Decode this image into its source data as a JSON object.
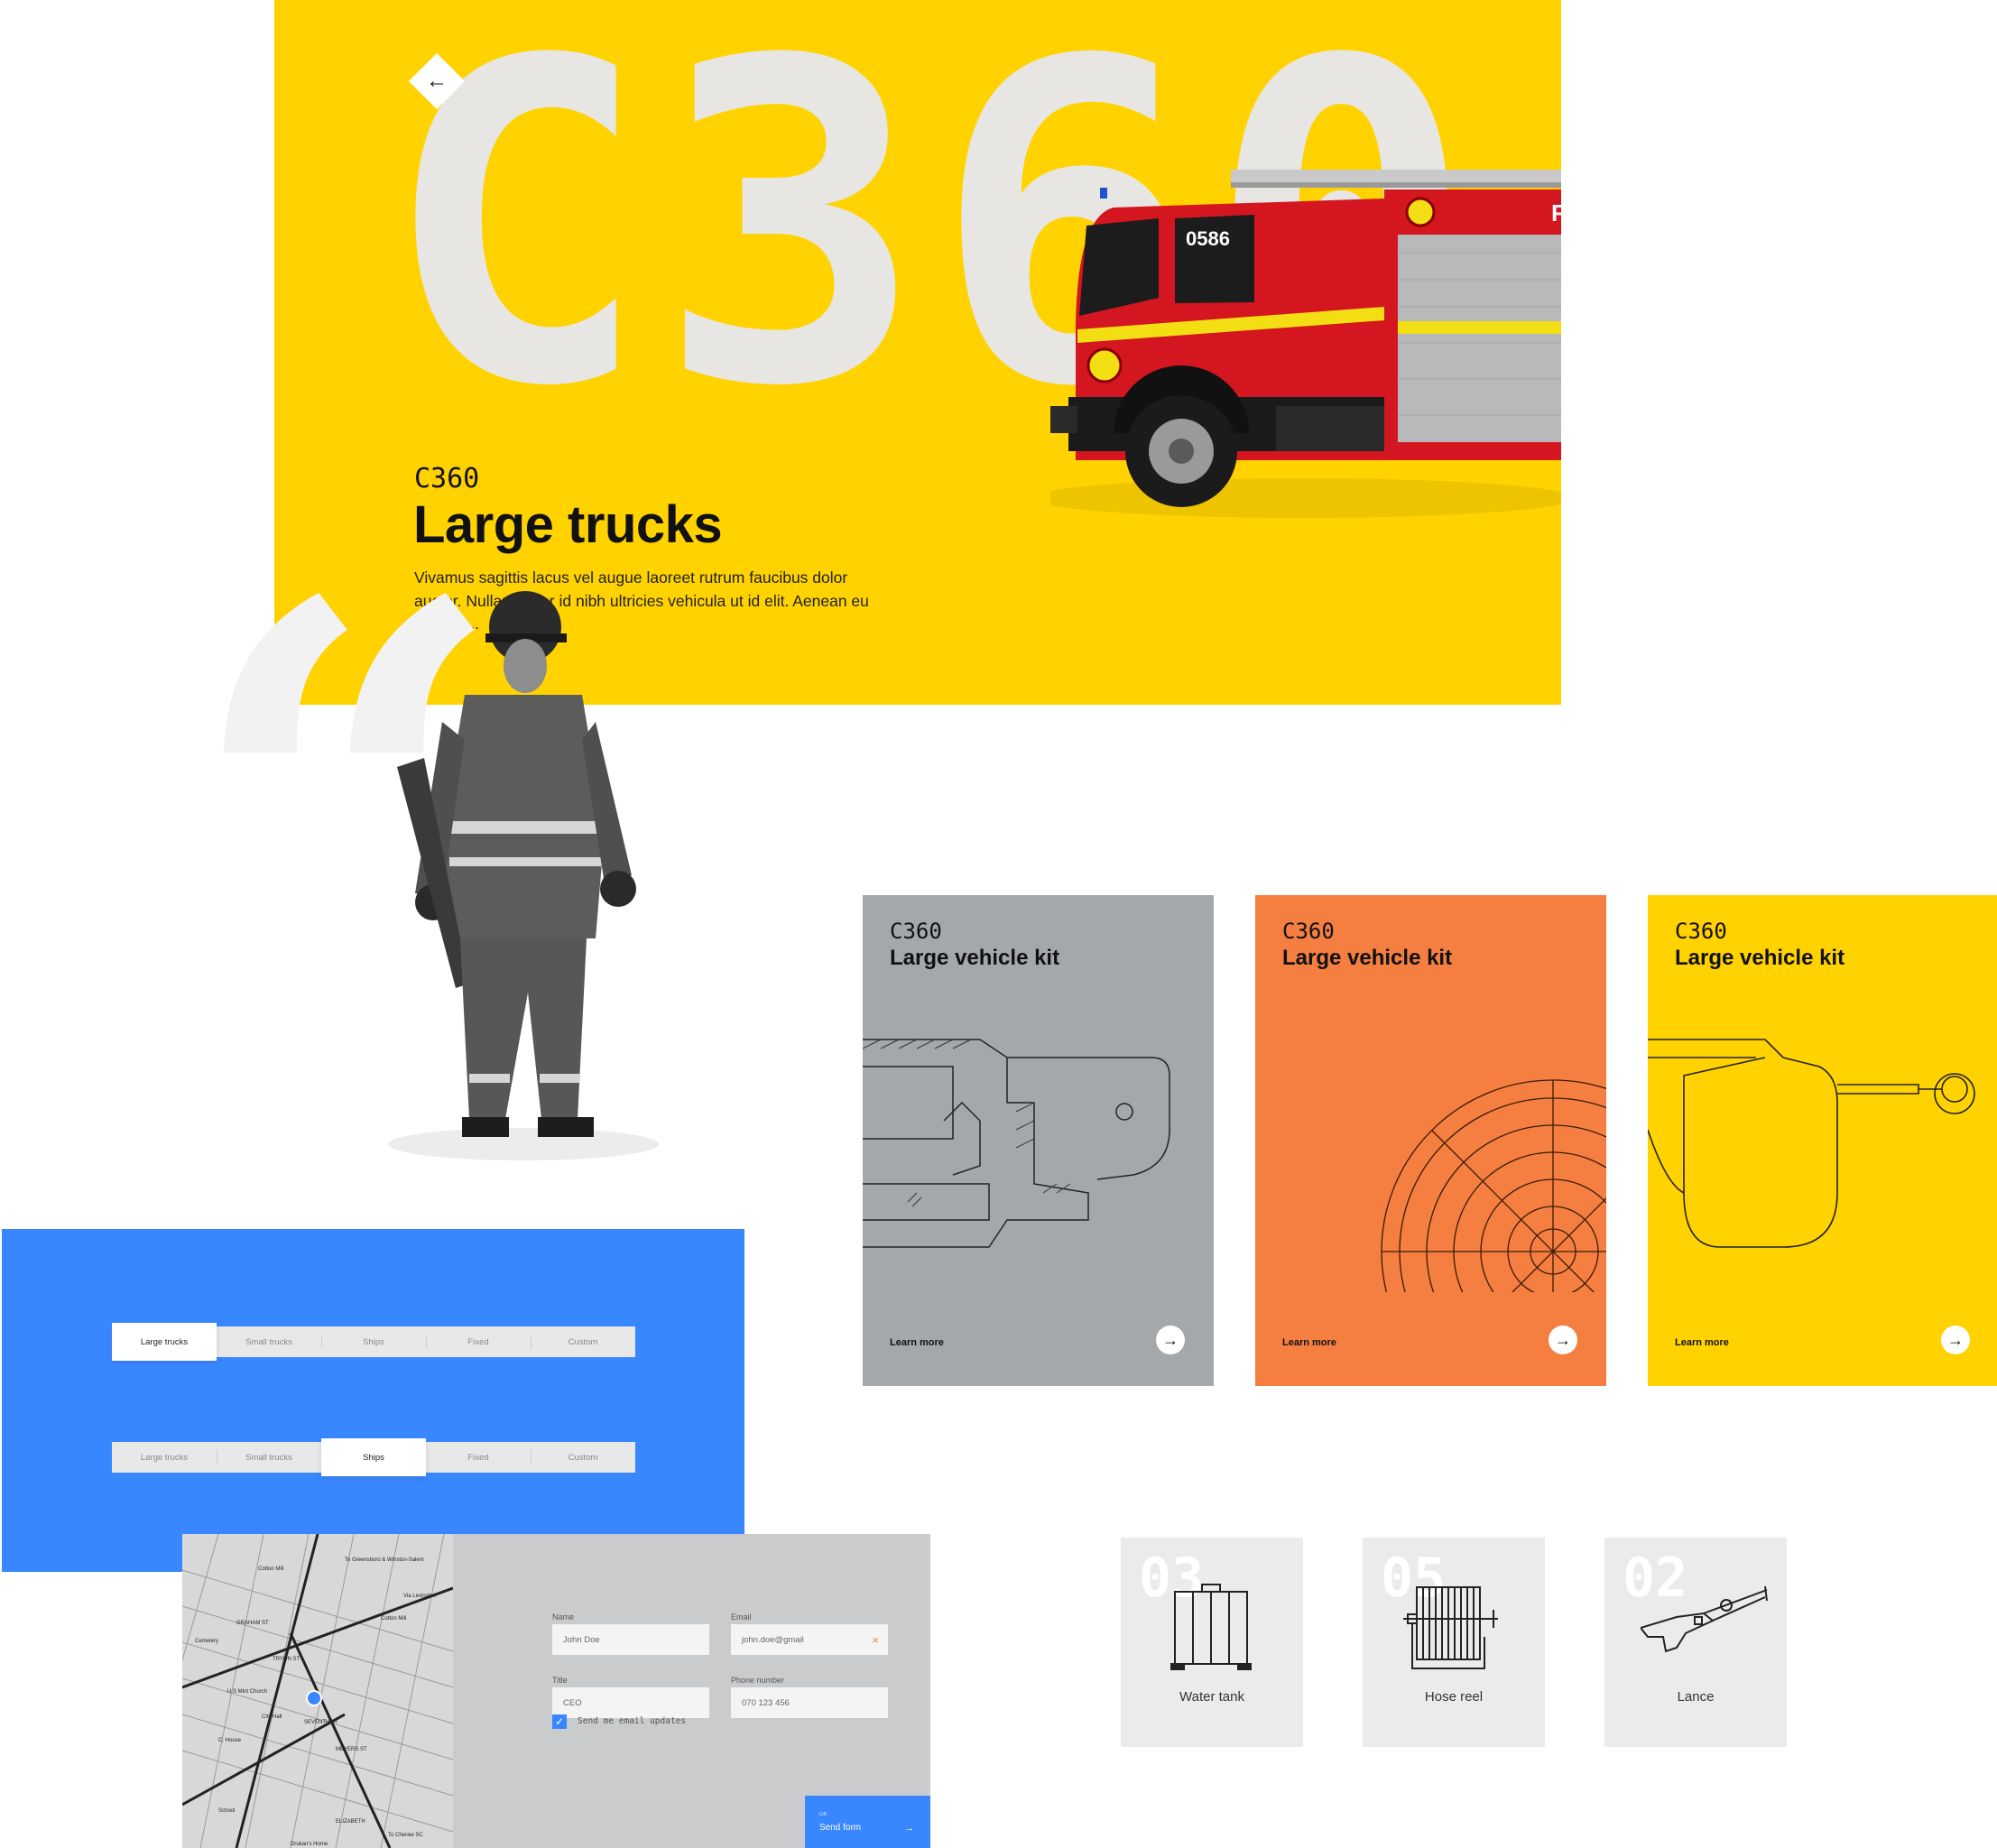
{
  "hero": {
    "big_text": "C360",
    "back_icon": "←",
    "eyebrow": "C360",
    "title": "Large trucks",
    "description": "Vivamus sagittis lacus vel augue laoreet rutrum faucibus dolor auctor. Nullam ... lor id nibh ultricies vehicula ut id elit. Aenean eu leo qua...",
    "truck_number": "0586",
    "truck_side_letter": "F",
    "bg_color": "#FFD200"
  },
  "tabs_default": {
    "items": [
      "Large trucks",
      "Small trucks",
      "Ships",
      "Fixed",
      "Custom"
    ],
    "active_index": 0
  },
  "tabs_selected": {
    "items": [
      "Large trucks",
      "Small trucks",
      "Ships",
      "Fixed",
      "Custom"
    ],
    "active_index": 2
  },
  "cards": [
    {
      "eyebrow": "C360",
      "title": "Large vehicle kit",
      "link": "Learn more",
      "color": "#A5A8AB"
    },
    {
      "eyebrow": "C360",
      "title": "Large vehicle kit",
      "link": "Learn more",
      "color": "#F47F41"
    },
    {
      "eyebrow": "C360",
      "title": "Large vehicle kit",
      "link": "Learn more",
      "color": "#FFD200"
    }
  ],
  "card_arrow": "→",
  "parts": [
    {
      "count": "03",
      "name": "Water tank",
      "icon": "water-tank-icon"
    },
    {
      "count": "05",
      "name": "Hose reel",
      "icon": "hose-reel-icon"
    },
    {
      "count": "02",
      "name": "Lance",
      "icon": "lance-icon"
    }
  ],
  "map": {
    "labels": [
      "Cotton Mill",
      "Cemetery",
      "GRAHAM ST",
      "TRYON ST",
      "U.S Mint Church",
      "City Hall",
      "C. House",
      "SEVENTH ST",
      "MEYERS ST",
      "School",
      "ELIZABETH",
      "To Greensboro & Winston-Salem",
      "Via Lexington",
      "To Cheraw SC",
      "Drukan's Home",
      "Cotton Mill"
    ]
  },
  "form": {
    "name_label": "Name",
    "name_value": "John Doe",
    "email_label": "Email",
    "email_value": "john.doe@gmail",
    "title_label": "Title",
    "title_value": "CEO",
    "phone_label": "Phone number",
    "phone_value": "070 123 456",
    "checkbox_label": "Send me email updates",
    "clear_icon": "×",
    "send_eyebrow": "OK",
    "send_label": "Send form",
    "send_arrow": "→"
  },
  "colors": {
    "blue": "#3987FF",
    "yellow": "#FFD200",
    "orange": "#F47F41",
    "grey": "#A5A8AB"
  }
}
